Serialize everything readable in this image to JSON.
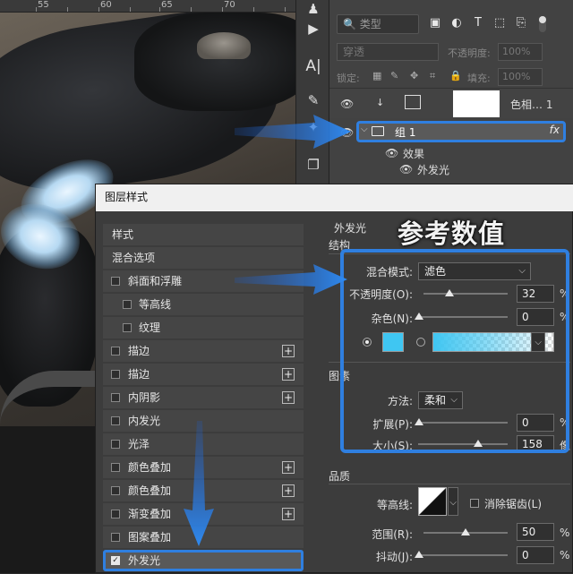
{
  "ruler": {
    "ticks": [
      "55",
      "60",
      "65",
      "70"
    ]
  },
  "layers_panel": {
    "kind_filter": "类型",
    "blend_mode": "穿透",
    "opacity_label": "不透明度:",
    "opacity_value": "100%",
    "lock_label": "锁定:",
    "fill_label": "填充:",
    "fill_value": "100%",
    "adjustment_layer_name": "色相… 1",
    "group_name": "组 1",
    "group_fx": "fx",
    "effects_label": "效果",
    "effect_item": "外发光"
  },
  "dialog": {
    "title": "图层样式",
    "styles": [
      {
        "label": "样式",
        "checkbox": false,
        "plus": false,
        "sub": false
      },
      {
        "label": "混合选项",
        "checkbox": false,
        "plus": false,
        "sub": false
      },
      {
        "label": "斜面和浮雕",
        "checkbox": true,
        "plus": false,
        "sub": false
      },
      {
        "label": "等高线",
        "checkbox": true,
        "plus": false,
        "sub": true
      },
      {
        "label": "纹理",
        "checkbox": true,
        "plus": false,
        "sub": true
      },
      {
        "label": "描边",
        "checkbox": true,
        "plus": true,
        "sub": false
      },
      {
        "label": "描边",
        "checkbox": true,
        "plus": true,
        "sub": false
      },
      {
        "label": "内阴影",
        "checkbox": true,
        "plus": true,
        "sub": false
      },
      {
        "label": "内发光",
        "checkbox": true,
        "plus": false,
        "sub": false
      },
      {
        "label": "光泽",
        "checkbox": true,
        "plus": false,
        "sub": false
      },
      {
        "label": "颜色叠加",
        "checkbox": true,
        "plus": true,
        "sub": false
      },
      {
        "label": "颜色叠加",
        "checkbox": true,
        "plus": true,
        "sub": false
      },
      {
        "label": "渐变叠加",
        "checkbox": true,
        "plus": true,
        "sub": false
      },
      {
        "label": "图案叠加",
        "checkbox": true,
        "plus": false,
        "sub": false
      },
      {
        "label": "外发光",
        "checkbox": true,
        "plus": false,
        "sub": false,
        "checked": true,
        "selected": true
      }
    ],
    "outer_glow": {
      "section_title": "外发光",
      "structure_title": "结构",
      "blend_mode_label": "混合模式:",
      "blend_mode_value": "滤色",
      "opacity_label": "不透明度(O):",
      "opacity_value": "32",
      "noise_label": "杂色(N):",
      "noise_value": "0",
      "percent": "%",
      "glow_color": "#3fc6f2",
      "elements_title": "图素",
      "technique_label": "方法:",
      "technique_value": "柔和",
      "spread_label": "扩展(P):",
      "spread_value": "0",
      "size_label": "大小(S):",
      "size_value": "158",
      "size_unit": "像",
      "quality_title": "品质",
      "contour_label": "等高线:",
      "anti_alias_label": "消除锯齿(L)",
      "range_label": "范围(R):",
      "range_value": "50",
      "jitter_label": "抖动(J):",
      "jitter_value": "0"
    }
  },
  "annotation": {
    "title": "参考数值"
  },
  "accent_color": "#2f7fe0"
}
